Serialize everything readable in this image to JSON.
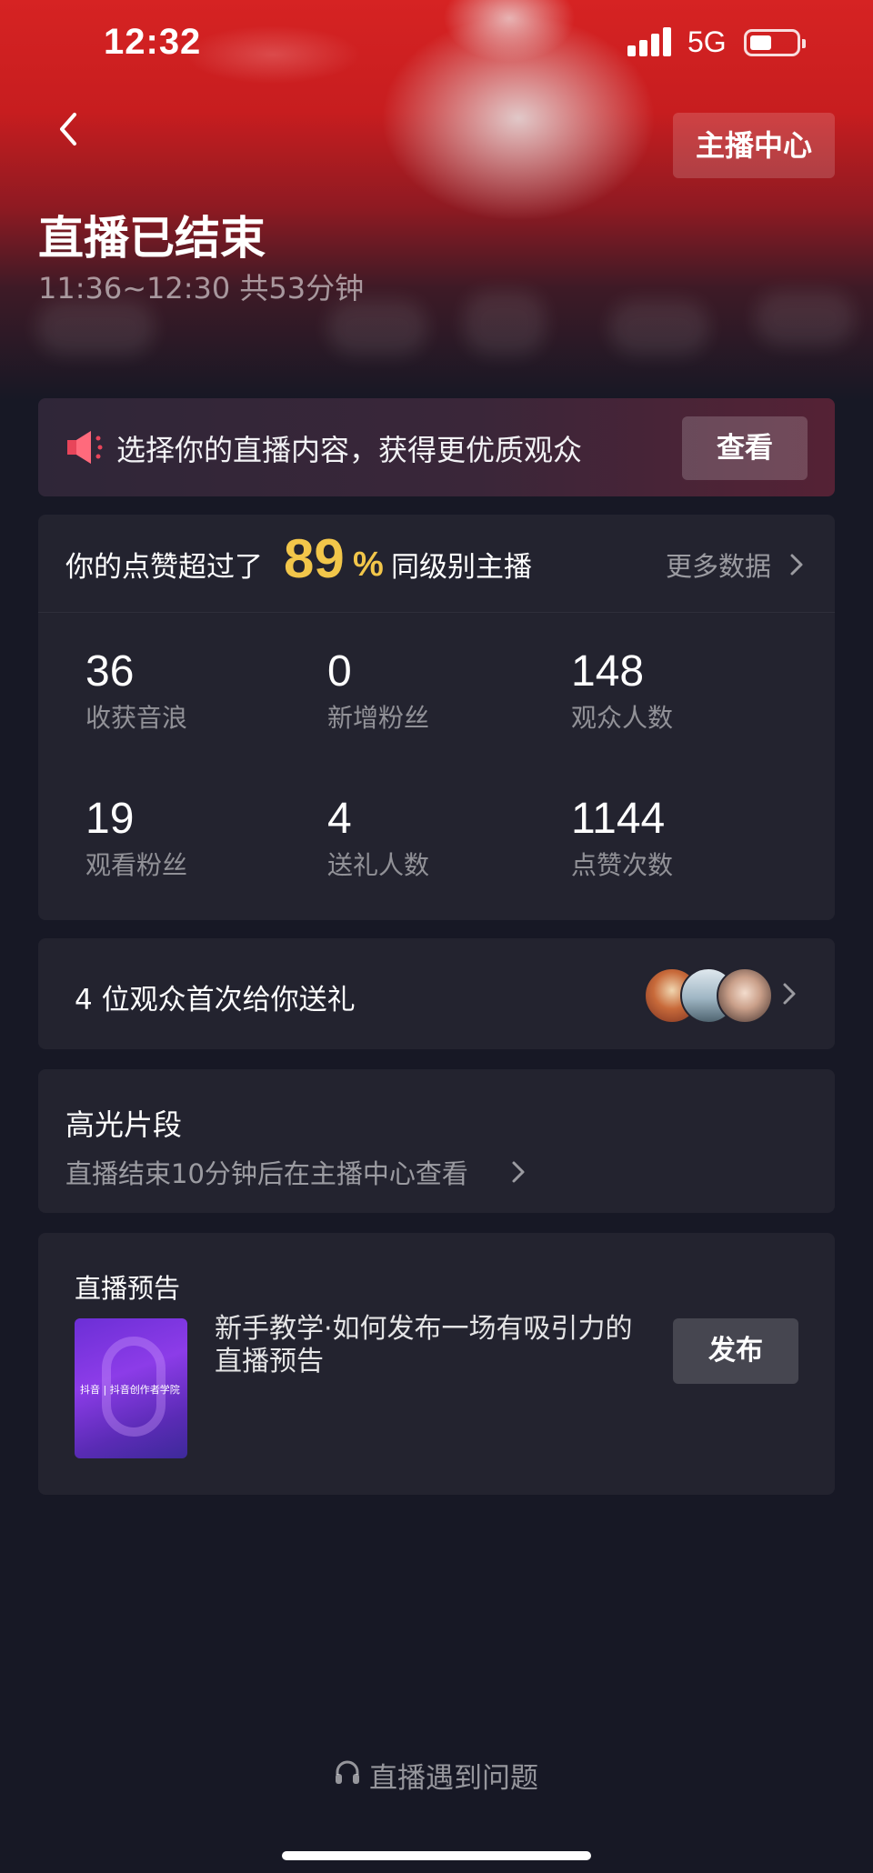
{
  "status_bar": {
    "time": "12:32",
    "network": "5G",
    "battery_level": 0.45
  },
  "header": {
    "back_icon": "chevron-left-icon",
    "center_button": "主播中心",
    "title": "直播已结束",
    "duration": "11:36~12:30 共53分钟"
  },
  "promo": {
    "icon": "megaphone-icon",
    "text": "选择你的直播内容，获得更优质观众",
    "button": "查看"
  },
  "stats": {
    "likes_prefix": "你的点赞超过了",
    "likes_percent": "89",
    "percent_sign": "%",
    "likes_suffix": "同级别主播",
    "more_data": "更多数据",
    "items": [
      {
        "value": "36",
        "label": "收获音浪"
      },
      {
        "value": "0",
        "label": "新增粉丝"
      },
      {
        "value": "148",
        "label": "观众人数"
      },
      {
        "value": "19",
        "label": "观看粉丝"
      },
      {
        "value": "4",
        "label": "送礼人数"
      },
      {
        "value": "1144",
        "label": "点赞次数"
      }
    ]
  },
  "gifts": {
    "text": "4 位观众首次给你送礼"
  },
  "highlights": {
    "title": "高光片段",
    "subtitle": "直播结束10分钟后在主播中心查看"
  },
  "preview": {
    "title": "直播预告",
    "thumb_caption": "抖音 | 抖音创作者学院",
    "text": "新手教学·如何发布一场有吸引力的直播预告",
    "button": "发布"
  },
  "footer": {
    "help_icon": "headset-icon",
    "help_text": "直播遇到问题"
  },
  "colors": {
    "accent": "#f2c64a",
    "hero_red": "#d62323",
    "background": "#171825",
    "card": "#23232f"
  }
}
